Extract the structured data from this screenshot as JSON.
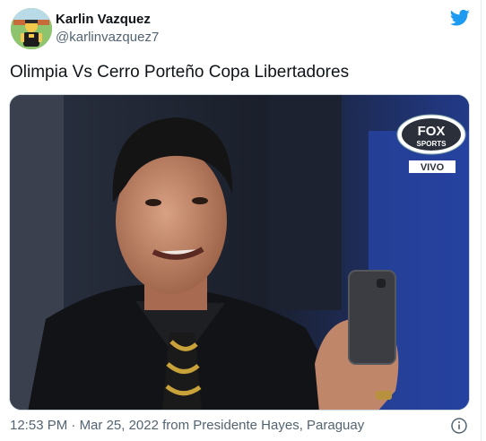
{
  "tweet": {
    "author_name": "Karlin Vazquez",
    "author_handle": "@karlinvazquez7",
    "text": "Olimpia Vs Cerro Porteño Copa Libertadores",
    "time": "12:53 PM",
    "separator": "·",
    "date": "Mar 25, 2022",
    "from_label": "from",
    "location": "Presidente Hayes, Paraguay"
  },
  "media": {
    "broadcaster_line1": "FOX",
    "broadcaster_line2": "SPORTS",
    "live_label": "VIVO"
  },
  "icons": {
    "platform": "twitter-bird-icon",
    "info": "info-icon"
  },
  "colors": {
    "brand": "#1d9bf0",
    "secondary_text": "#536471"
  }
}
